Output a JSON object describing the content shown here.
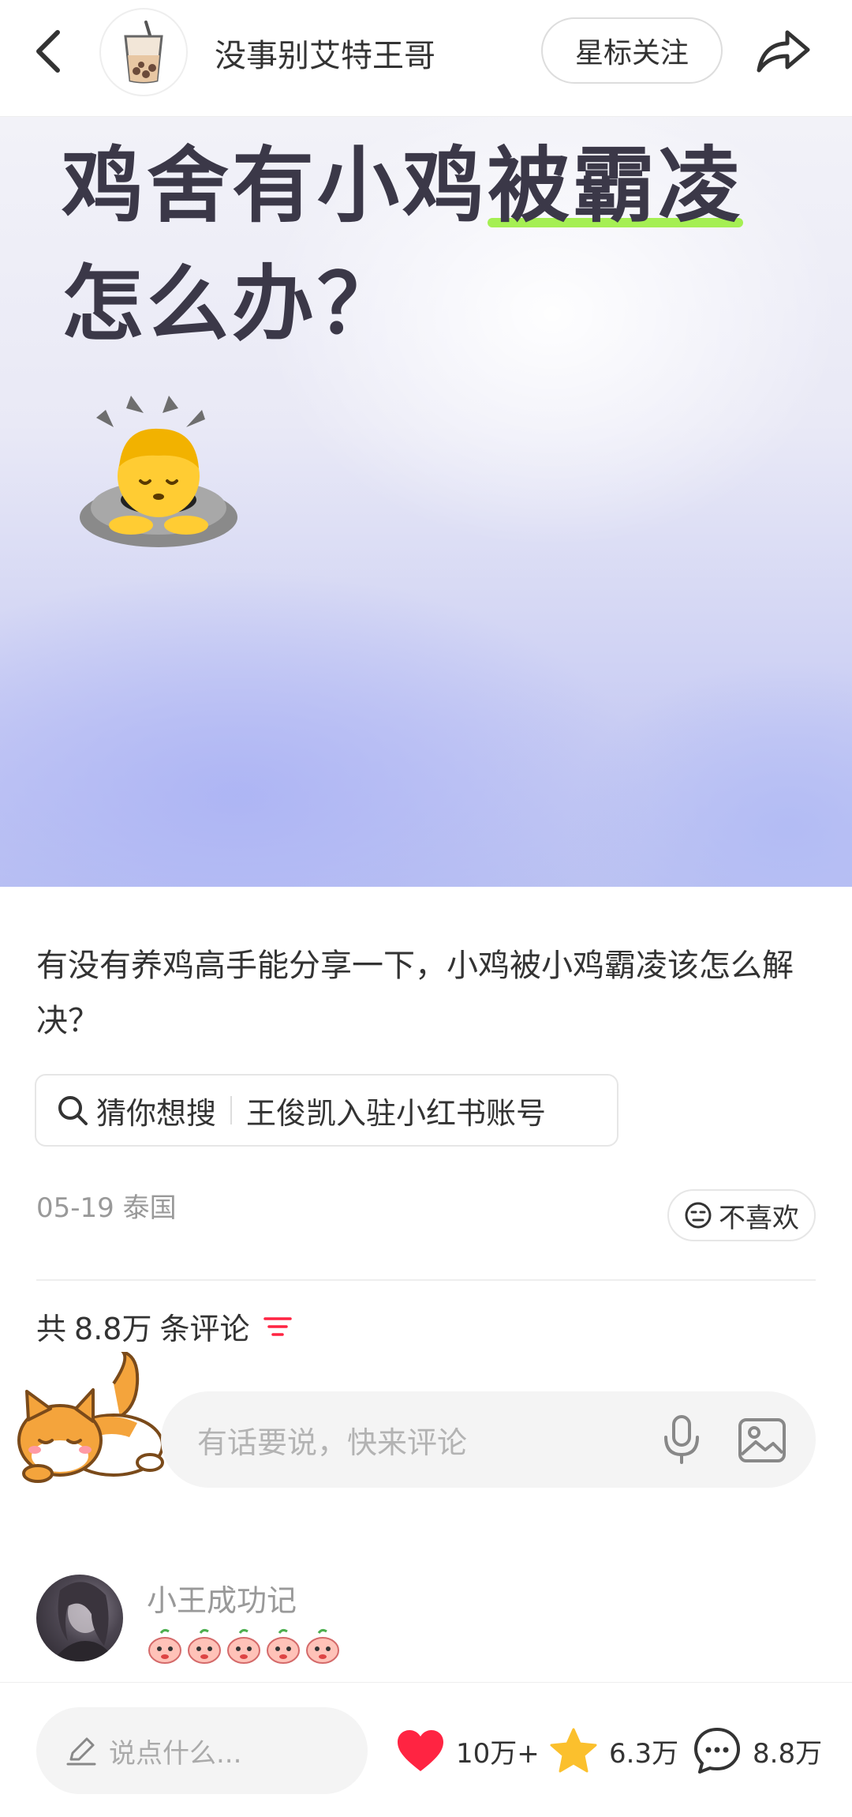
{
  "header": {
    "author_name": "没事别艾特王哥",
    "star_follow_label": "星标关注"
  },
  "cover": {
    "title_line1_plain": "鸡舍有小鸡",
    "title_line1_highlight": "被霸凌",
    "title_line2": "怎么办？",
    "highlight_color": "#a5ef53"
  },
  "post": {
    "text": "有没有养鸡高手能分享一下，小鸡被小鸡霸凌该怎么解决？",
    "search_prefix": "猜你想搜",
    "search_suggestion": "王俊凯入驻小红书账号",
    "date_location": "05-19 泰国",
    "dislike_label": "不喜欢"
  },
  "comments": {
    "count_prefix": "共",
    "count": "8.8万",
    "count_suffix": "条评论",
    "input_placeholder": "有话要说，快来评论",
    "first_commenter_name": "小王成功记",
    "first_comment_emoji_count": 5
  },
  "bottom_bar": {
    "say_placeholder": "说点什么...",
    "likes": "10万+",
    "favorites": "6.3万",
    "comments": "8.8万"
  },
  "colors": {
    "like_red": "#ff2442",
    "star_yellow": "#fbc02d",
    "filter_red": "#ff2442"
  }
}
